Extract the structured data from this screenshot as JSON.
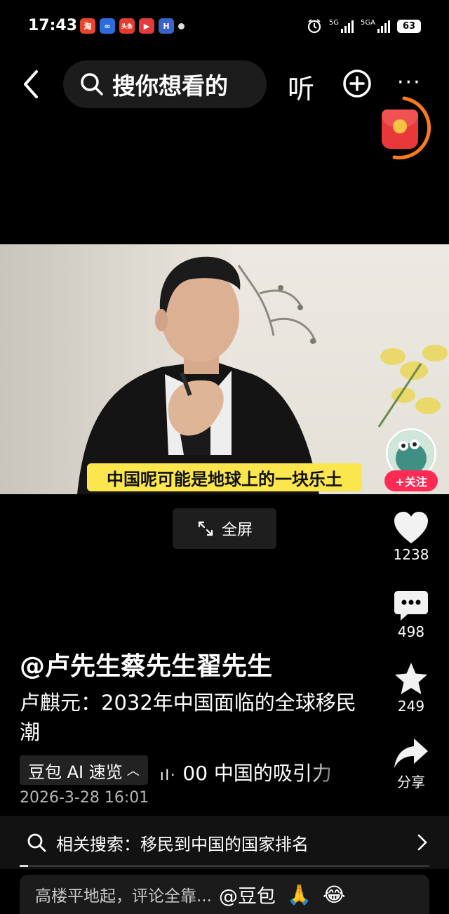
{
  "status_bar": {
    "time": "17:43",
    "app_icons": [
      {
        "name": "taobao-icon",
        "glyph": "淘",
        "color": "#e8452c"
      },
      {
        "name": "cloud-drive-icon",
        "glyph": "∞",
        "color": "#2d6cdf"
      },
      {
        "name": "toutiao-icon",
        "glyph": "头条",
        "color": "#e33b2e"
      },
      {
        "name": "video-app-icon",
        "glyph": "▶",
        "color": "#e23b3b"
      },
      {
        "name": "h-app-icon",
        "glyph": "H",
        "color": "#3a63c9"
      }
    ],
    "network_1": "5G",
    "network_2": "5GA",
    "battery": "63"
  },
  "nav": {
    "search_placeholder": "搜你想看的",
    "listen_label": "听"
  },
  "video": {
    "subtitle": "中国呢可能是地球上的一块乐土"
  },
  "fullscreen_label": "全屏",
  "rail": {
    "follow_label": "+关注",
    "likes": "1238",
    "comments": "498",
    "favorites": "249",
    "share_label": "分享"
  },
  "post": {
    "author": "@卢先生蔡先生翟先生",
    "title": "卢麒元：2032年中国面临的全球移民潮",
    "ai_tag": "豆包 AI 速览",
    "ai_summary": "00 中国的吸引力",
    "date": "2026-3-28 16:01"
  },
  "related": {
    "label": "相关搜索：移民到中国的国家排名"
  },
  "progress": 0.02,
  "comment": {
    "placeholder": "高楼平地起，评论全靠...",
    "mention": "@豆包",
    "emoji_1": "🙏",
    "emoji_2": "😂"
  }
}
